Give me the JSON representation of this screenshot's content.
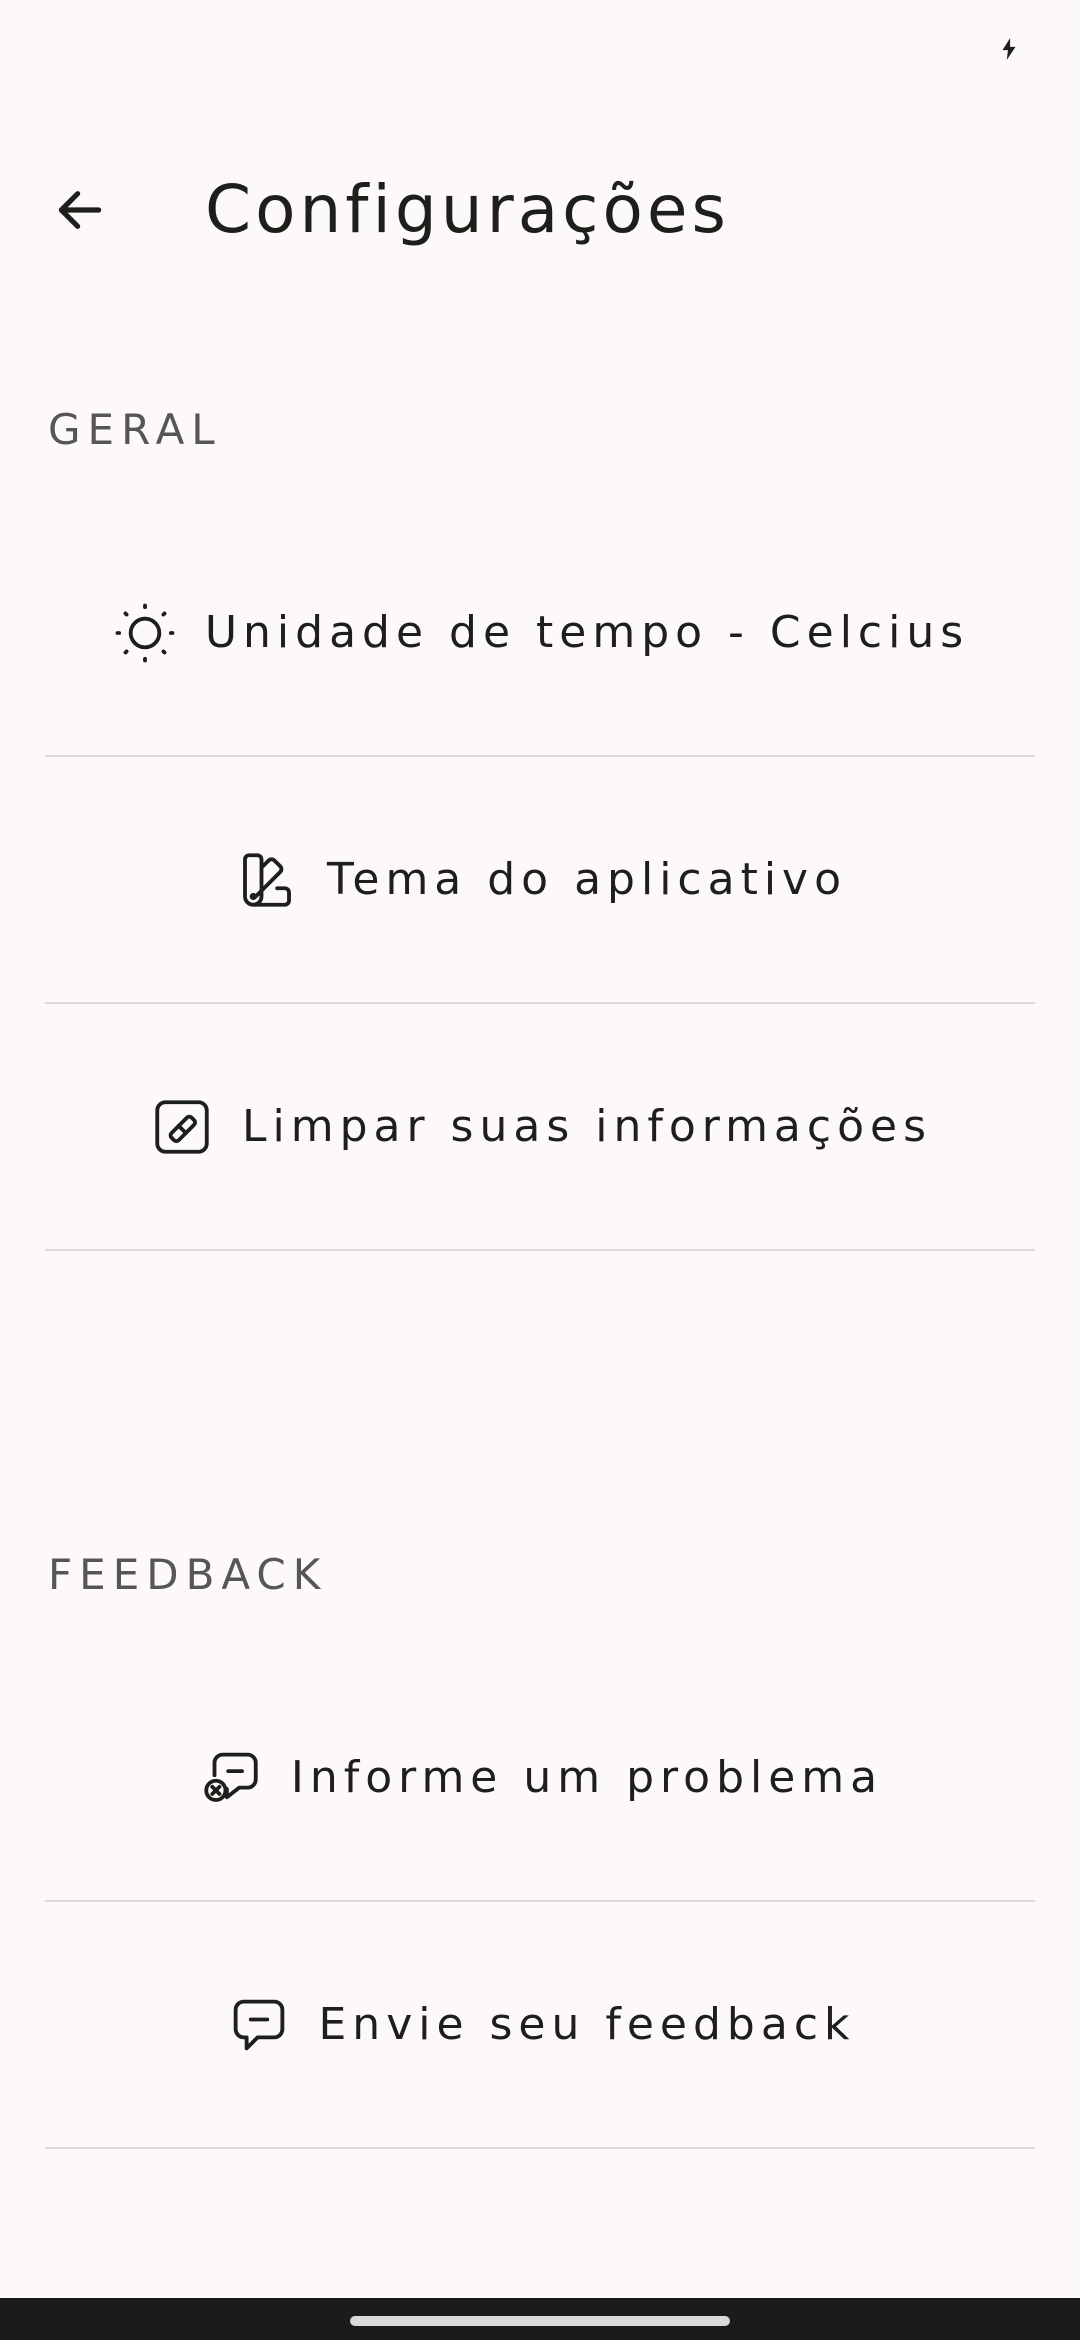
{
  "status_bar": {
    "time": "",
    "battery_icon": "battery-charging-icon"
  },
  "app_bar": {
    "back_icon": "arrow-back-icon",
    "title": "Configurações"
  },
  "sections": {
    "general": {
      "header": "GERAL",
      "items": [
        {
          "icon": "sun-icon",
          "label": "Unidade de tempo - Celcius"
        },
        {
          "icon": "palette-swatch-icon",
          "label": "Tema do aplicativo"
        },
        {
          "icon": "eraser-icon",
          "label": "Limpar suas informações"
        }
      ]
    },
    "feedback": {
      "header": "FEEDBACK",
      "items": [
        {
          "icon": "message-report-icon",
          "label": "Informe um problema"
        },
        {
          "icon": "message-feedback-icon",
          "label": "Envie seu feedback"
        }
      ]
    }
  },
  "colors": {
    "background": "#fdf9fb",
    "text": "#1d1f1a",
    "section_header": "#555752",
    "divider": "#dcdadc",
    "nav_bar": "#1b1b1b"
  }
}
